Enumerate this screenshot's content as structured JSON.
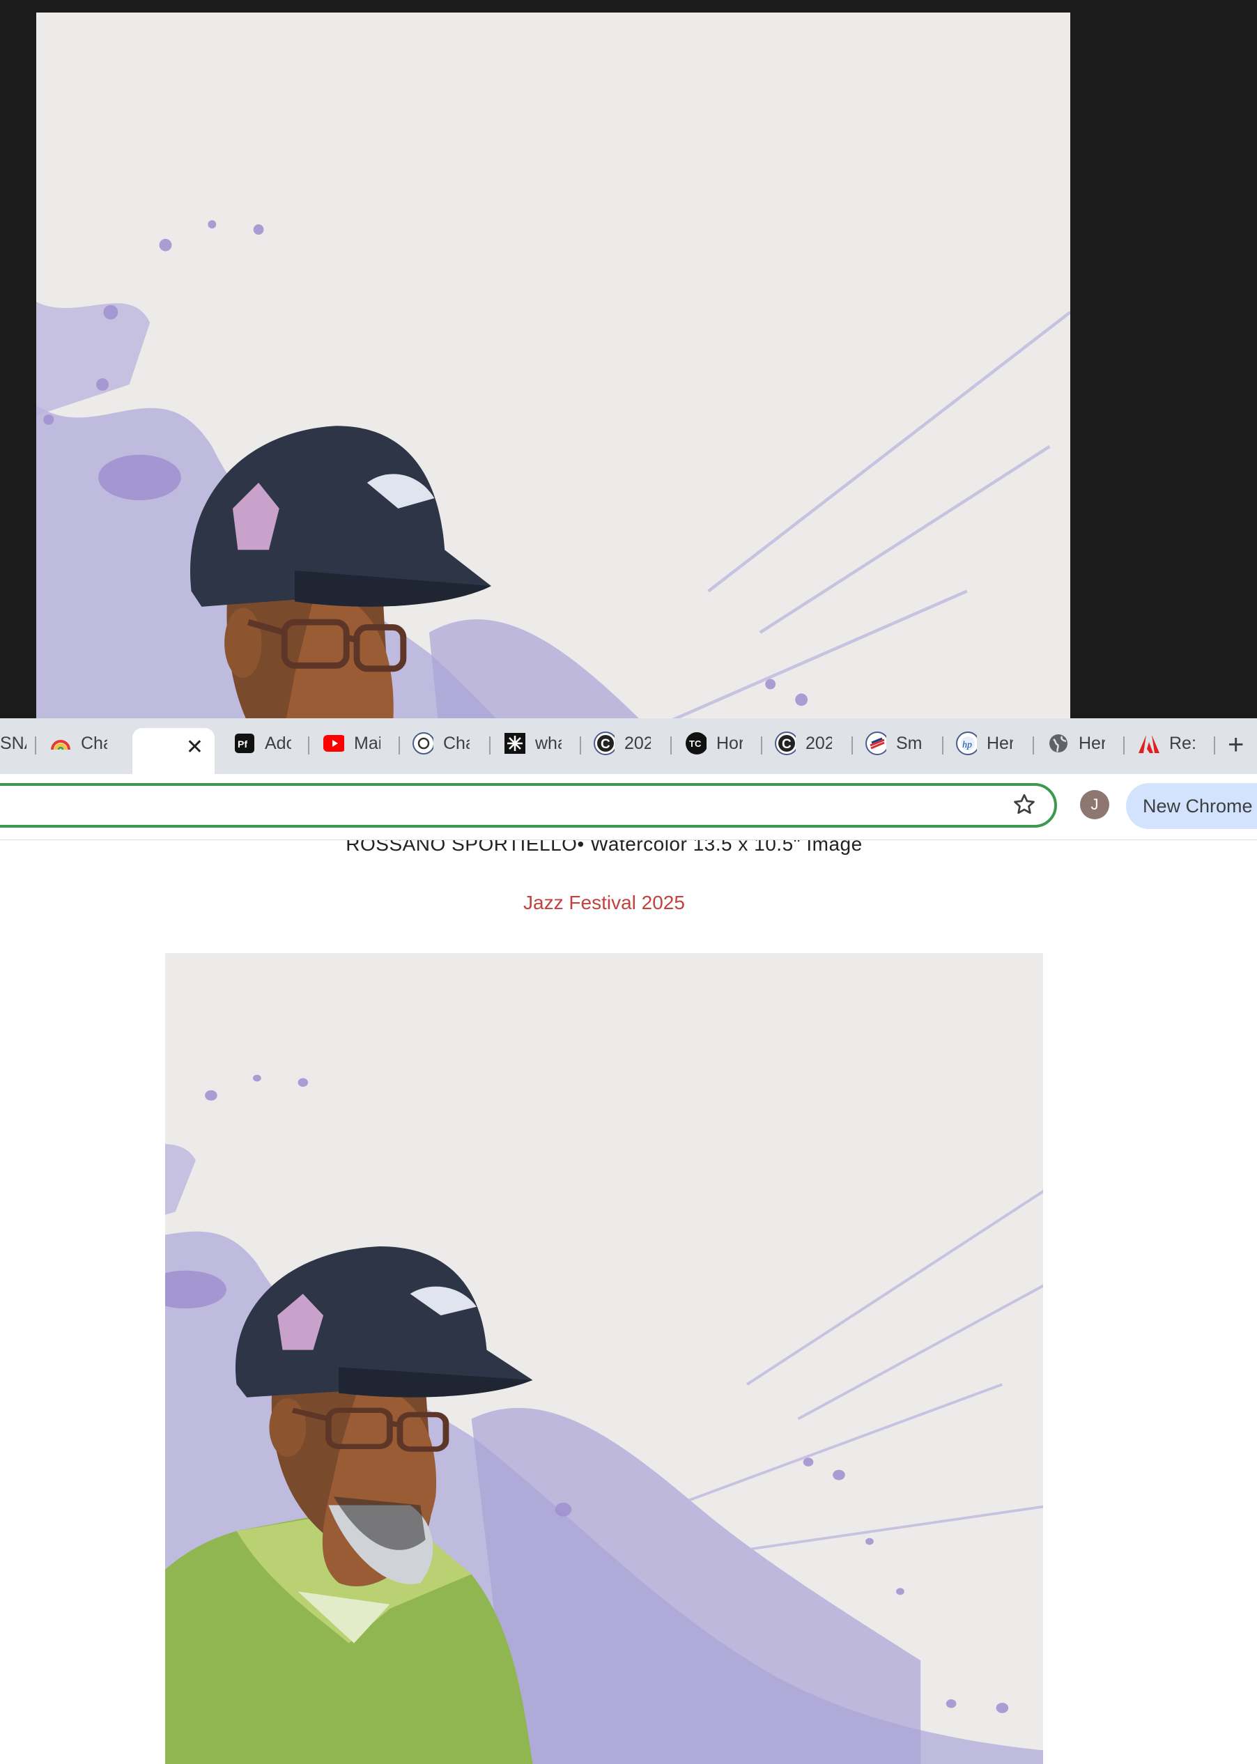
{
  "viewer": {
    "image_alt": "Watercolor painting of a man in a navy cap, glasses and green shirt with purple splashes"
  },
  "tabs": [
    {
      "label": "SNA",
      "icon": "none"
    },
    {
      "label": "Cha",
      "icon": "rainbow-icon"
    },
    {
      "label": "",
      "icon": "close-icon",
      "active": true
    },
    {
      "label": "Ado",
      "icon": "pf-icon"
    },
    {
      "label": "Mai",
      "icon": "youtube-icon"
    },
    {
      "label": "Cha",
      "icon": "openai-icon"
    },
    {
      "label": "wha",
      "icon": "spark-icon"
    },
    {
      "label": "202",
      "icon": "c-circle-icon"
    },
    {
      "label": "Hor",
      "icon": "tc-icon"
    },
    {
      "label": "202",
      "icon": "c-circle-icon"
    },
    {
      "label": "Sm",
      "icon": "bank-flag-icon"
    },
    {
      "label": "Her",
      "icon": "hp-icon"
    },
    {
      "label": "Her",
      "icon": "globe-icon"
    },
    {
      "label": "Re:",
      "icon": "adobe-icon"
    }
  ],
  "new_tab_symbol": "+",
  "toolbar": {
    "avatar_initial": "J",
    "new_chrome_label": "New Chrome"
  },
  "page": {
    "caption": "ROSSANO SPORTIELLO•  Watercolor   13.5 x 10.5\" Image",
    "event_title": "Jazz Festival 2025"
  },
  "colors": {
    "accent_green": "#3c9a4e",
    "event_red": "#c0433e",
    "tab_strip": "#dfe3e8",
    "new_chrome_bg": "#d3e3fd"
  }
}
